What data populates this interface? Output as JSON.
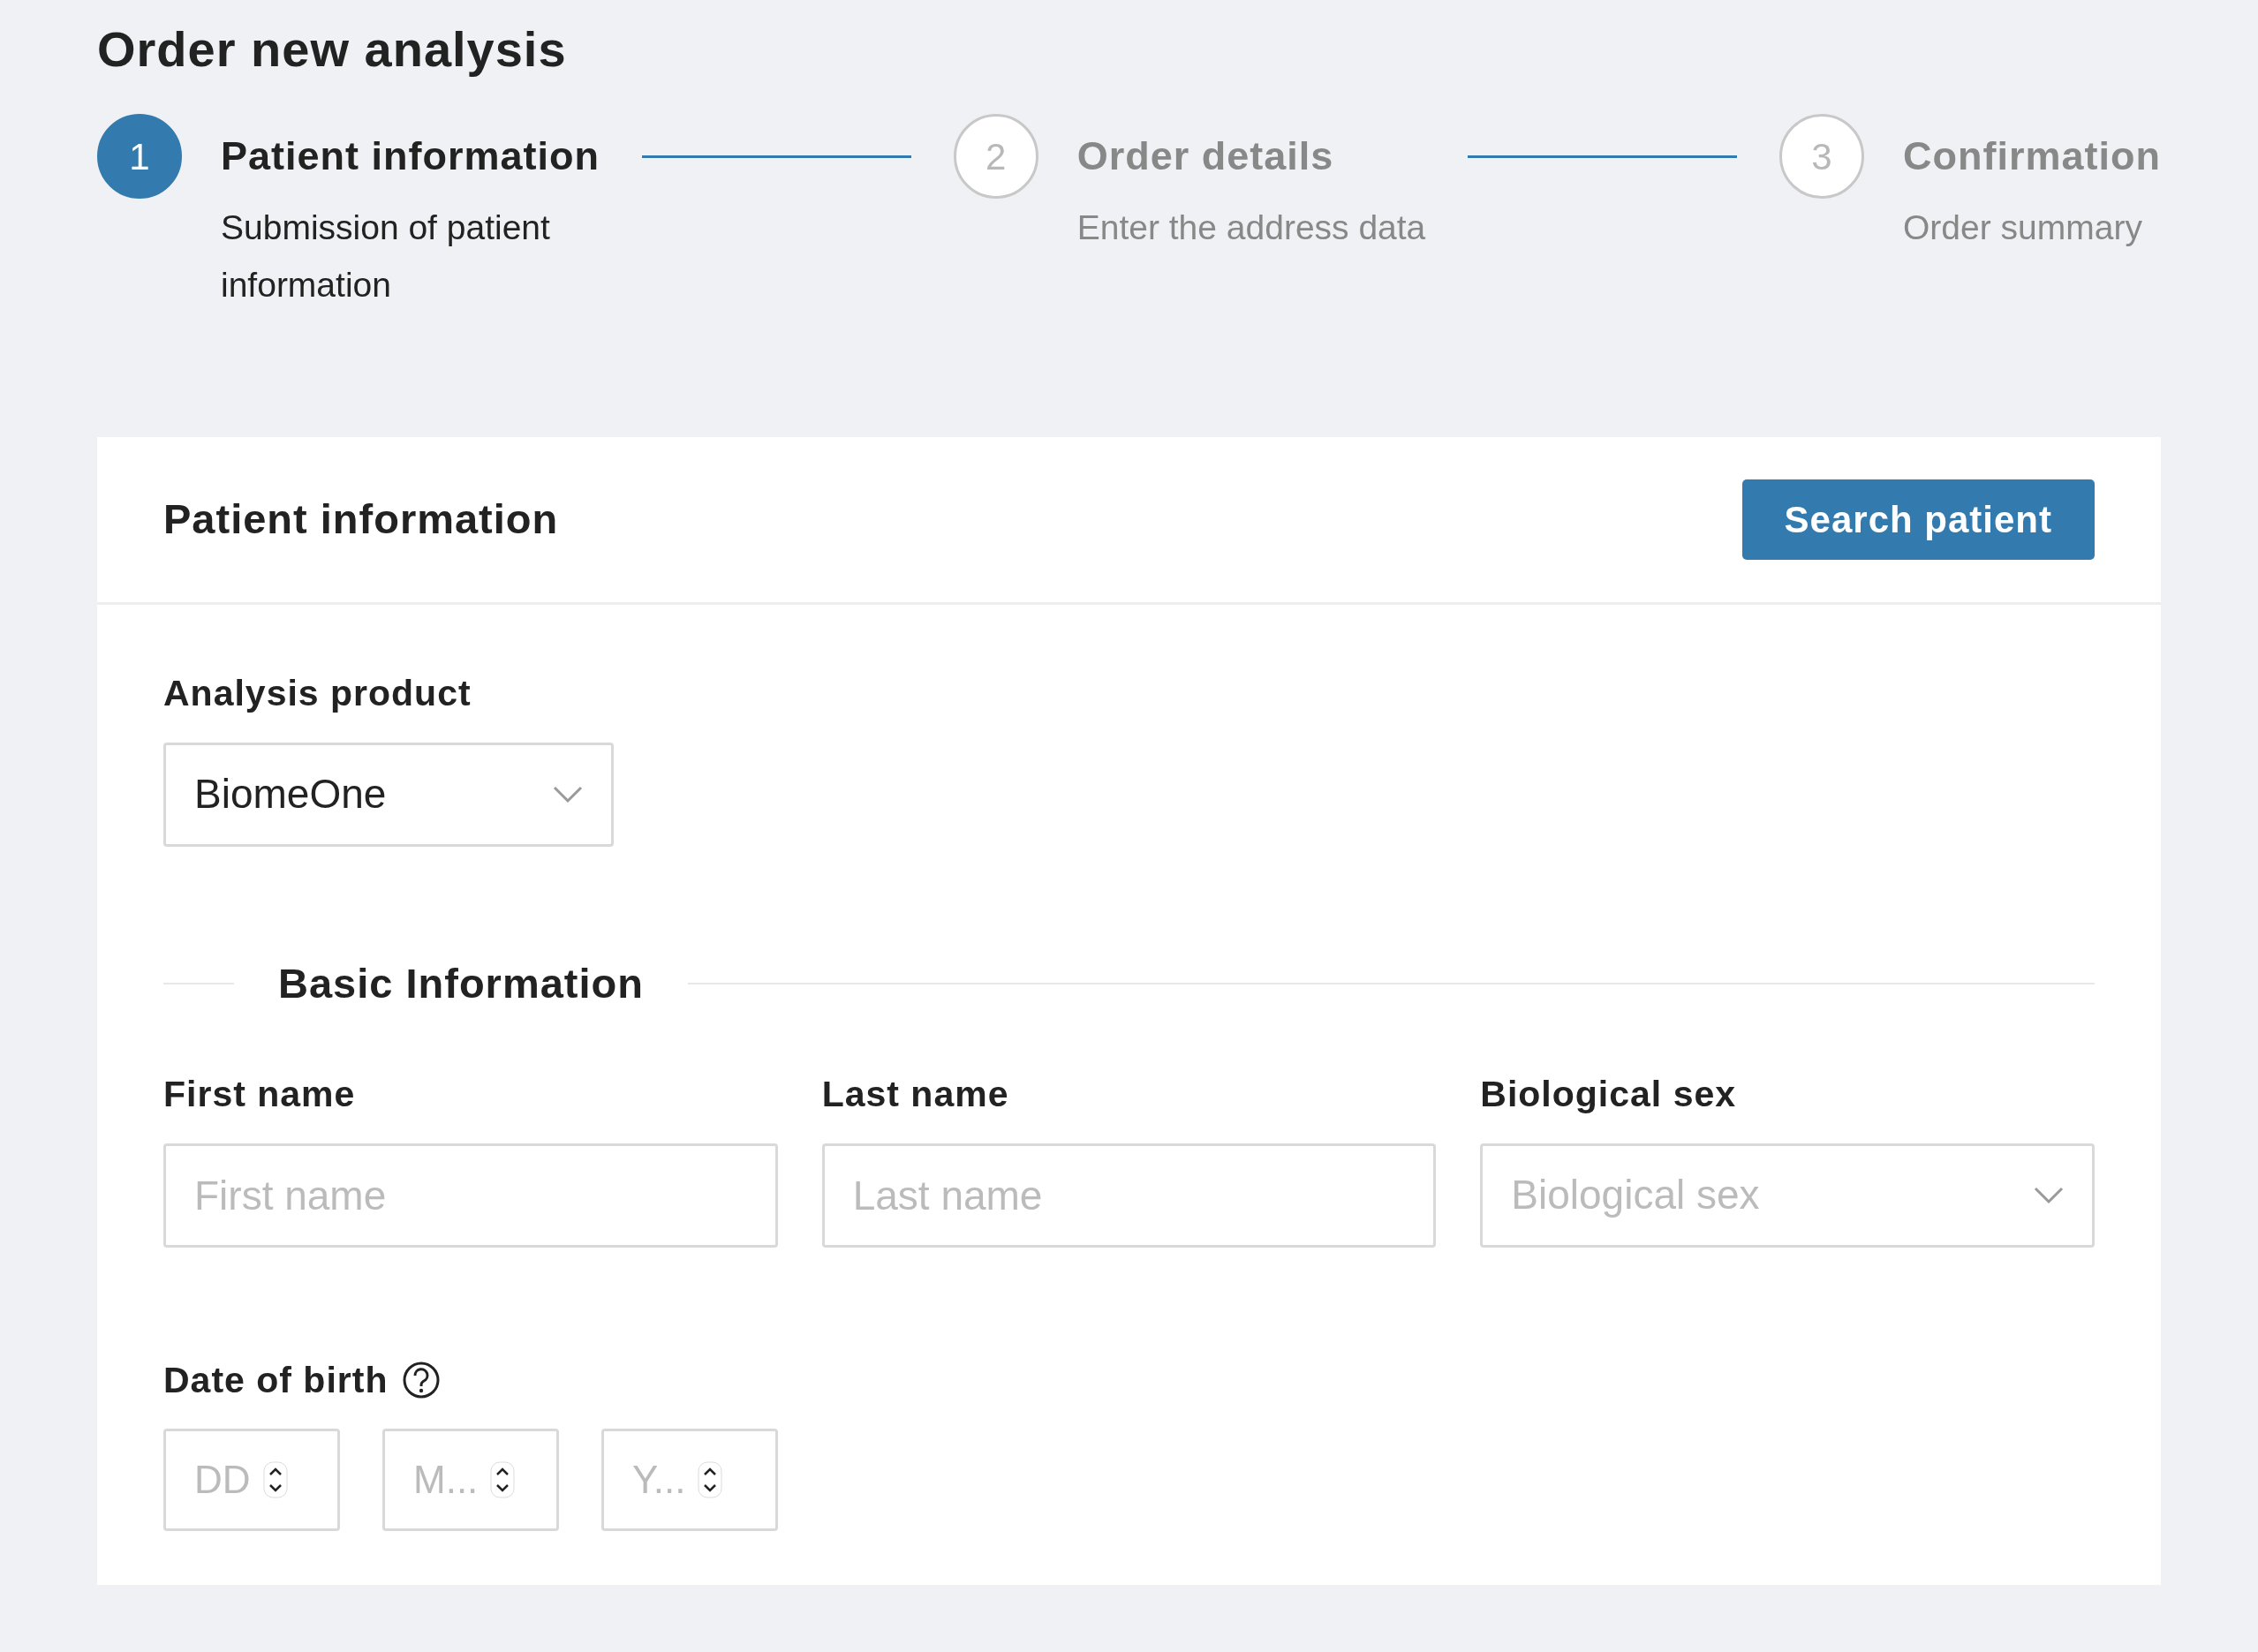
{
  "page_title": "Order new analysis",
  "steps": [
    {
      "number": "1",
      "title": "Patient information",
      "subtitle": "Submission of patient information",
      "selected": true
    },
    {
      "number": "2",
      "title": "Order details",
      "subtitle": "Enter the address data",
      "selected": false
    },
    {
      "number": "3",
      "title": "Confirmation",
      "subtitle": "Order summary",
      "selected": false
    }
  ],
  "card": {
    "title": "Patient information",
    "search_button": "Search patient",
    "analysis_product": {
      "label": "Analysis product",
      "value": "BiomeOne"
    },
    "section_title": "Basic Information",
    "fields": [
      {
        "kind": "text",
        "label": "First name",
        "placeholder": "First name"
      },
      {
        "kind": "text",
        "label": "Last name",
        "placeholder": "Last name"
      },
      {
        "kind": "select",
        "label": "Biological sex",
        "placeholder": "Biological sex"
      }
    ],
    "date_of_birth": {
      "label": "Date of birth",
      "parts": [
        {
          "placeholder": "DD"
        },
        {
          "placeholder": "M..."
        },
        {
          "placeholder": "Y..."
        }
      ]
    }
  }
}
